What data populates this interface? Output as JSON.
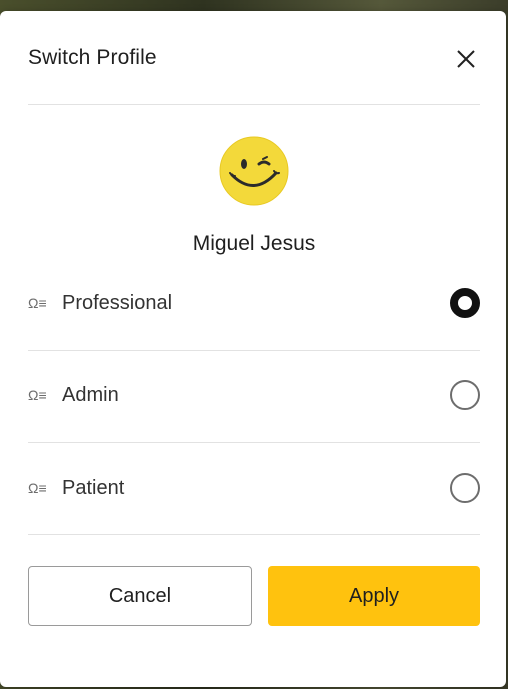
{
  "dialog": {
    "title": "Switch Profile",
    "close_icon": "close-icon"
  },
  "user": {
    "name": "Miguel Jesus",
    "avatar_icon": "winking-smiley-icon"
  },
  "profiles": [
    {
      "label": "Professional",
      "icon": "role-icon",
      "selected": true
    },
    {
      "label": "Admin",
      "icon": "role-icon",
      "selected": false
    },
    {
      "label": "Patient",
      "icon": "role-icon",
      "selected": false
    }
  ],
  "role_icon_glyph": "Ω≡",
  "buttons": {
    "cancel_label": "Cancel",
    "apply_label": "Apply"
  },
  "colors": {
    "accent": "#ffc20e",
    "radio_selected": "#111111",
    "divider": "#e2e2e2"
  }
}
